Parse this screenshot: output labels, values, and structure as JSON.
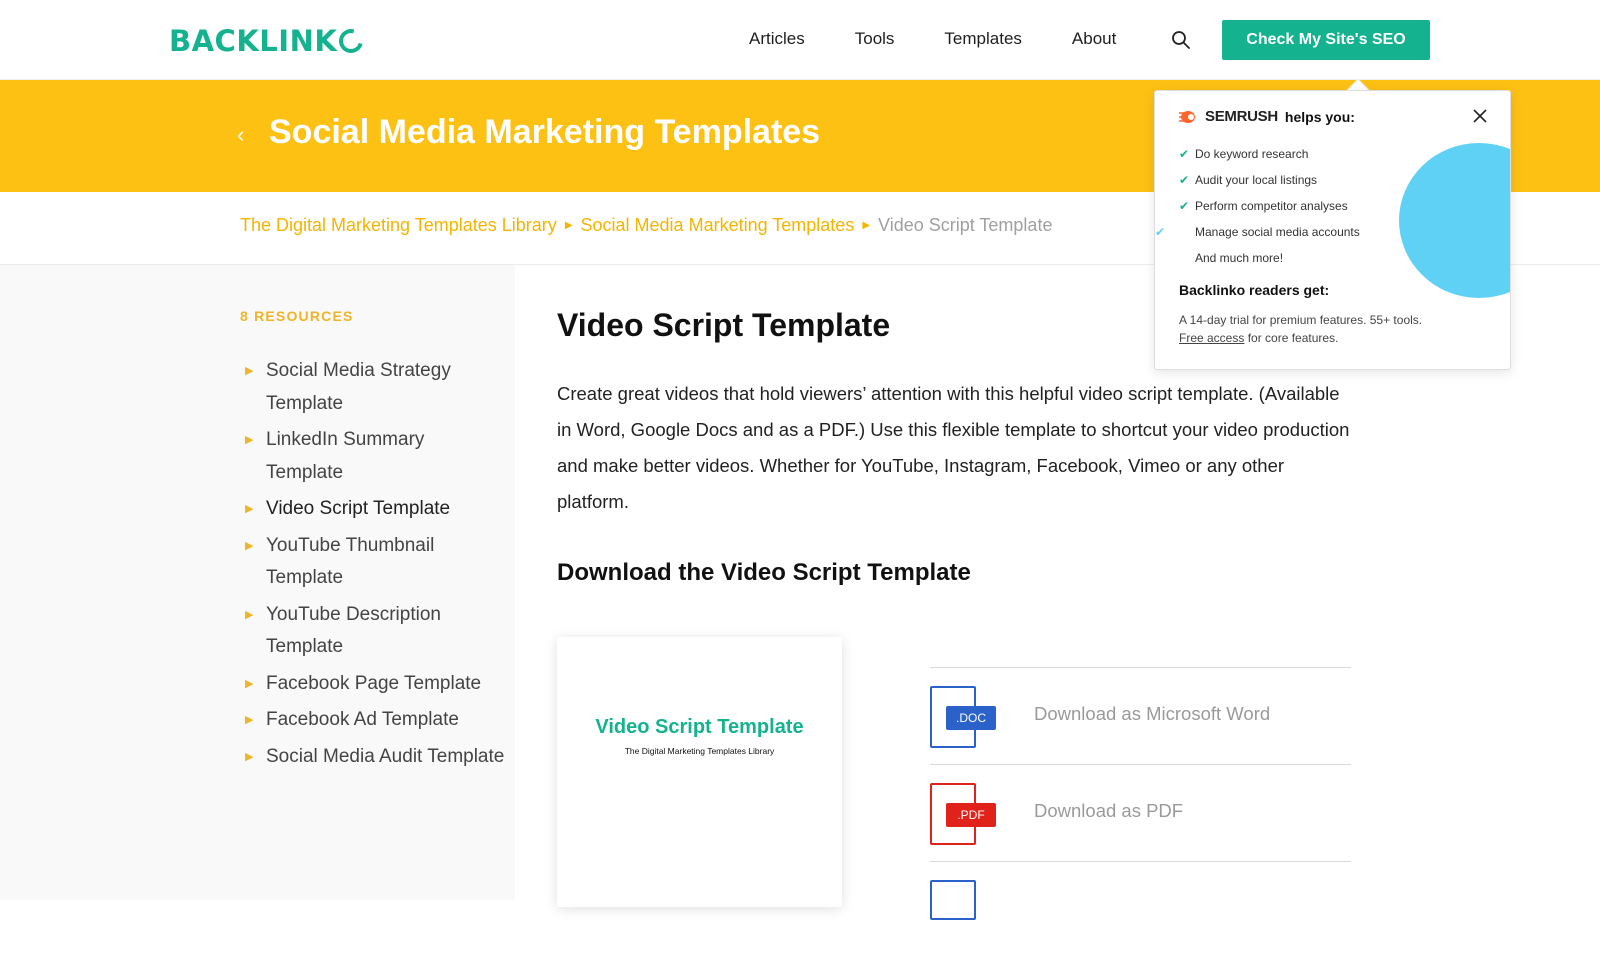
{
  "header": {
    "logo_text": "BACKLINK",
    "nav": [
      "Articles",
      "Tools",
      "Templates",
      "About"
    ],
    "search_icon": "search-icon",
    "cta_label": "Check My Site's SEO",
    "brand_color": "#14b28f"
  },
  "banner": {
    "back_icon": "chevron-left-icon",
    "title": "Social Media Marketing Templates",
    "color": "#fdc114"
  },
  "breadcrumb": {
    "items": [
      "The Digital Marketing Templates Library",
      "Social Media Marketing Templates"
    ],
    "current": "Video Script Template"
  },
  "sidebar": {
    "count_label": "8 RESOURCES",
    "items": [
      "Social Media Strategy Template",
      "LinkedIn Summary Template",
      "Video Script Template",
      "YouTube Thumbnail Template",
      "YouTube Description Template",
      "Facebook Page Template",
      "Facebook Ad Template",
      "Social Media Audit Template"
    ]
  },
  "main": {
    "title": "Video Script Template",
    "description": "Create great videos that hold viewers’ attention with this helpful video script template. (Available in Word, Google Docs and as a PDF.) Use this flexible template to shortcut your video production and make better videos. Whether for YouTube, Instagram, Facebook, Vimeo or any other platform.",
    "download_heading": "Download the Video Script Template",
    "preview": {
      "title": "Video Script Template",
      "subtitle": "The Digital Marketing Templates Library"
    },
    "downloads": [
      {
        "tag": ".DOC",
        "label": "Download as Microsoft Word",
        "icon": "word-file-icon"
      },
      {
        "tag": ".PDF",
        "label": "Download as PDF",
        "icon": "pdf-file-icon"
      }
    ]
  },
  "popup": {
    "brand": "SEMRUSH",
    "helps_label": "helps you:",
    "features": [
      "Do keyword research",
      "Audit your local listings",
      "Perform competitor analyses",
      "Manage social media accounts",
      "And much more!"
    ],
    "readers_heading": "Backlinko readers get:",
    "trial_text": "A 14-day trial for premium features. 55+ tools.",
    "free_access_link": "Free access",
    "free_access_rest": " for core features."
  }
}
